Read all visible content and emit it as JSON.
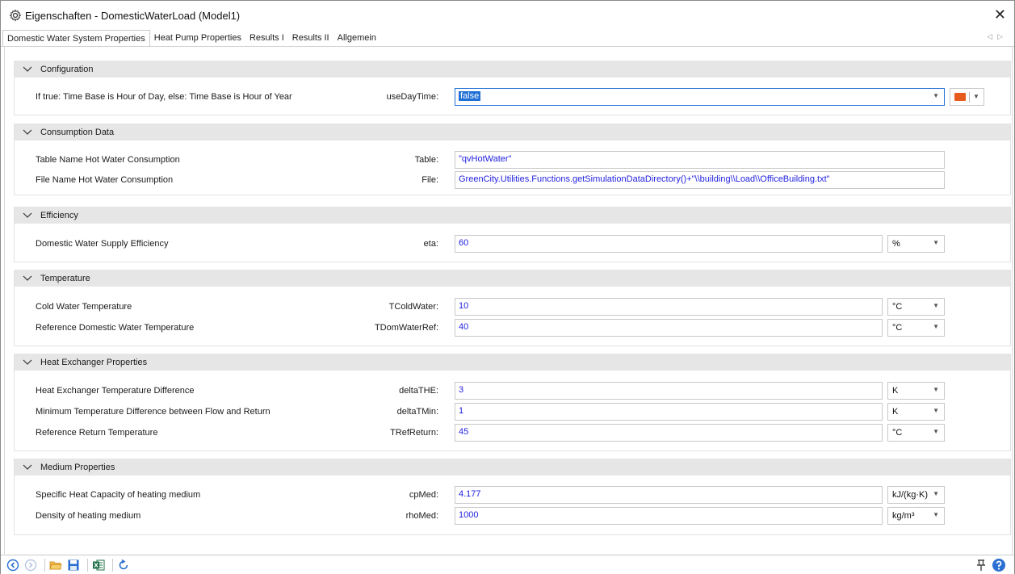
{
  "window": {
    "title": "Eigenschaften - DomesticWaterLoad (Model1)",
    "close_glyph": "✕"
  },
  "tabs": [
    {
      "label": "Domestic Water System Properties",
      "active": true
    },
    {
      "label": "Heat Pump Properties"
    },
    {
      "label": "Results I"
    },
    {
      "label": "Results II"
    },
    {
      "label": "Allgemein"
    }
  ],
  "sections": {
    "configuration": {
      "title": "Configuration",
      "rows": [
        {
          "desc": "If true: Time Base is Hour of Day, else: Time Base is Hour of Year",
          "param": "useDayTime:",
          "value": "false"
        }
      ]
    },
    "consumption": {
      "title": "Consumption Data",
      "rows": [
        {
          "desc": "Table Name Hot Water Consumption",
          "param": "Table:",
          "value": "\"qvHotWater\""
        },
        {
          "desc": "File Name Hot Water Consumption",
          "param": "File:",
          "value": "GreenCity.Utilities.Functions.getSimulationDataDirectory()+\"\\\\building\\\\Load\\\\OfficeBuilding.txt\""
        }
      ]
    },
    "efficiency": {
      "title": "Efficiency",
      "rows": [
        {
          "desc": "Domestic Water Supply Efficiency",
          "param": "eta:",
          "value": "60",
          "unit": "%"
        }
      ]
    },
    "temperature": {
      "title": "Temperature",
      "rows": [
        {
          "desc": "Cold Water Temperature",
          "param": "TColdWater:",
          "value": "10",
          "unit": "°C"
        },
        {
          "desc": "Reference Domestic Water Temperature",
          "param": "TDomWaterRef:",
          "value": "40",
          "unit": "°C"
        }
      ]
    },
    "heat_exchanger": {
      "title": "Heat Exchanger Properties",
      "rows": [
        {
          "desc": "Heat Exchanger Temperature Difference",
          "param": "deltaTHE:",
          "value": "3",
          "unit": "K"
        },
        {
          "desc": "Minimum Temperature Difference between Flow and Return",
          "param": "deltaTMin:",
          "value": "1",
          "unit": "K"
        },
        {
          "desc": "Reference Return Temperature",
          "param": "TRefReturn:",
          "value": "45",
          "unit": "°C"
        }
      ]
    },
    "medium": {
      "title": "Medium Properties",
      "rows": [
        {
          "desc": "Specific Heat Capacity of heating medium",
          "param": "cpMed:",
          "value": "4.177",
          "unit": "kJ/(kg·K)"
        },
        {
          "desc": "Density of heating medium",
          "param": "rhoMed:",
          "value": "1000",
          "unit": "kg/m³"
        }
      ]
    }
  },
  "colors": {
    "value_text": "#1f1fe0",
    "section_header_bg": "#e6e6e6",
    "selection": "#1f6fd6",
    "excel_green": "#1e7145",
    "toolbar_blue": "#2a6fd1"
  },
  "icons": {
    "title": "gear-icon",
    "bottom_left": [
      "back-icon",
      "forward-icon",
      "open-folder-icon",
      "save-icon",
      "excel-icon",
      "refresh-icon"
    ],
    "bottom_right": [
      "pin-icon",
      "help-icon"
    ]
  }
}
